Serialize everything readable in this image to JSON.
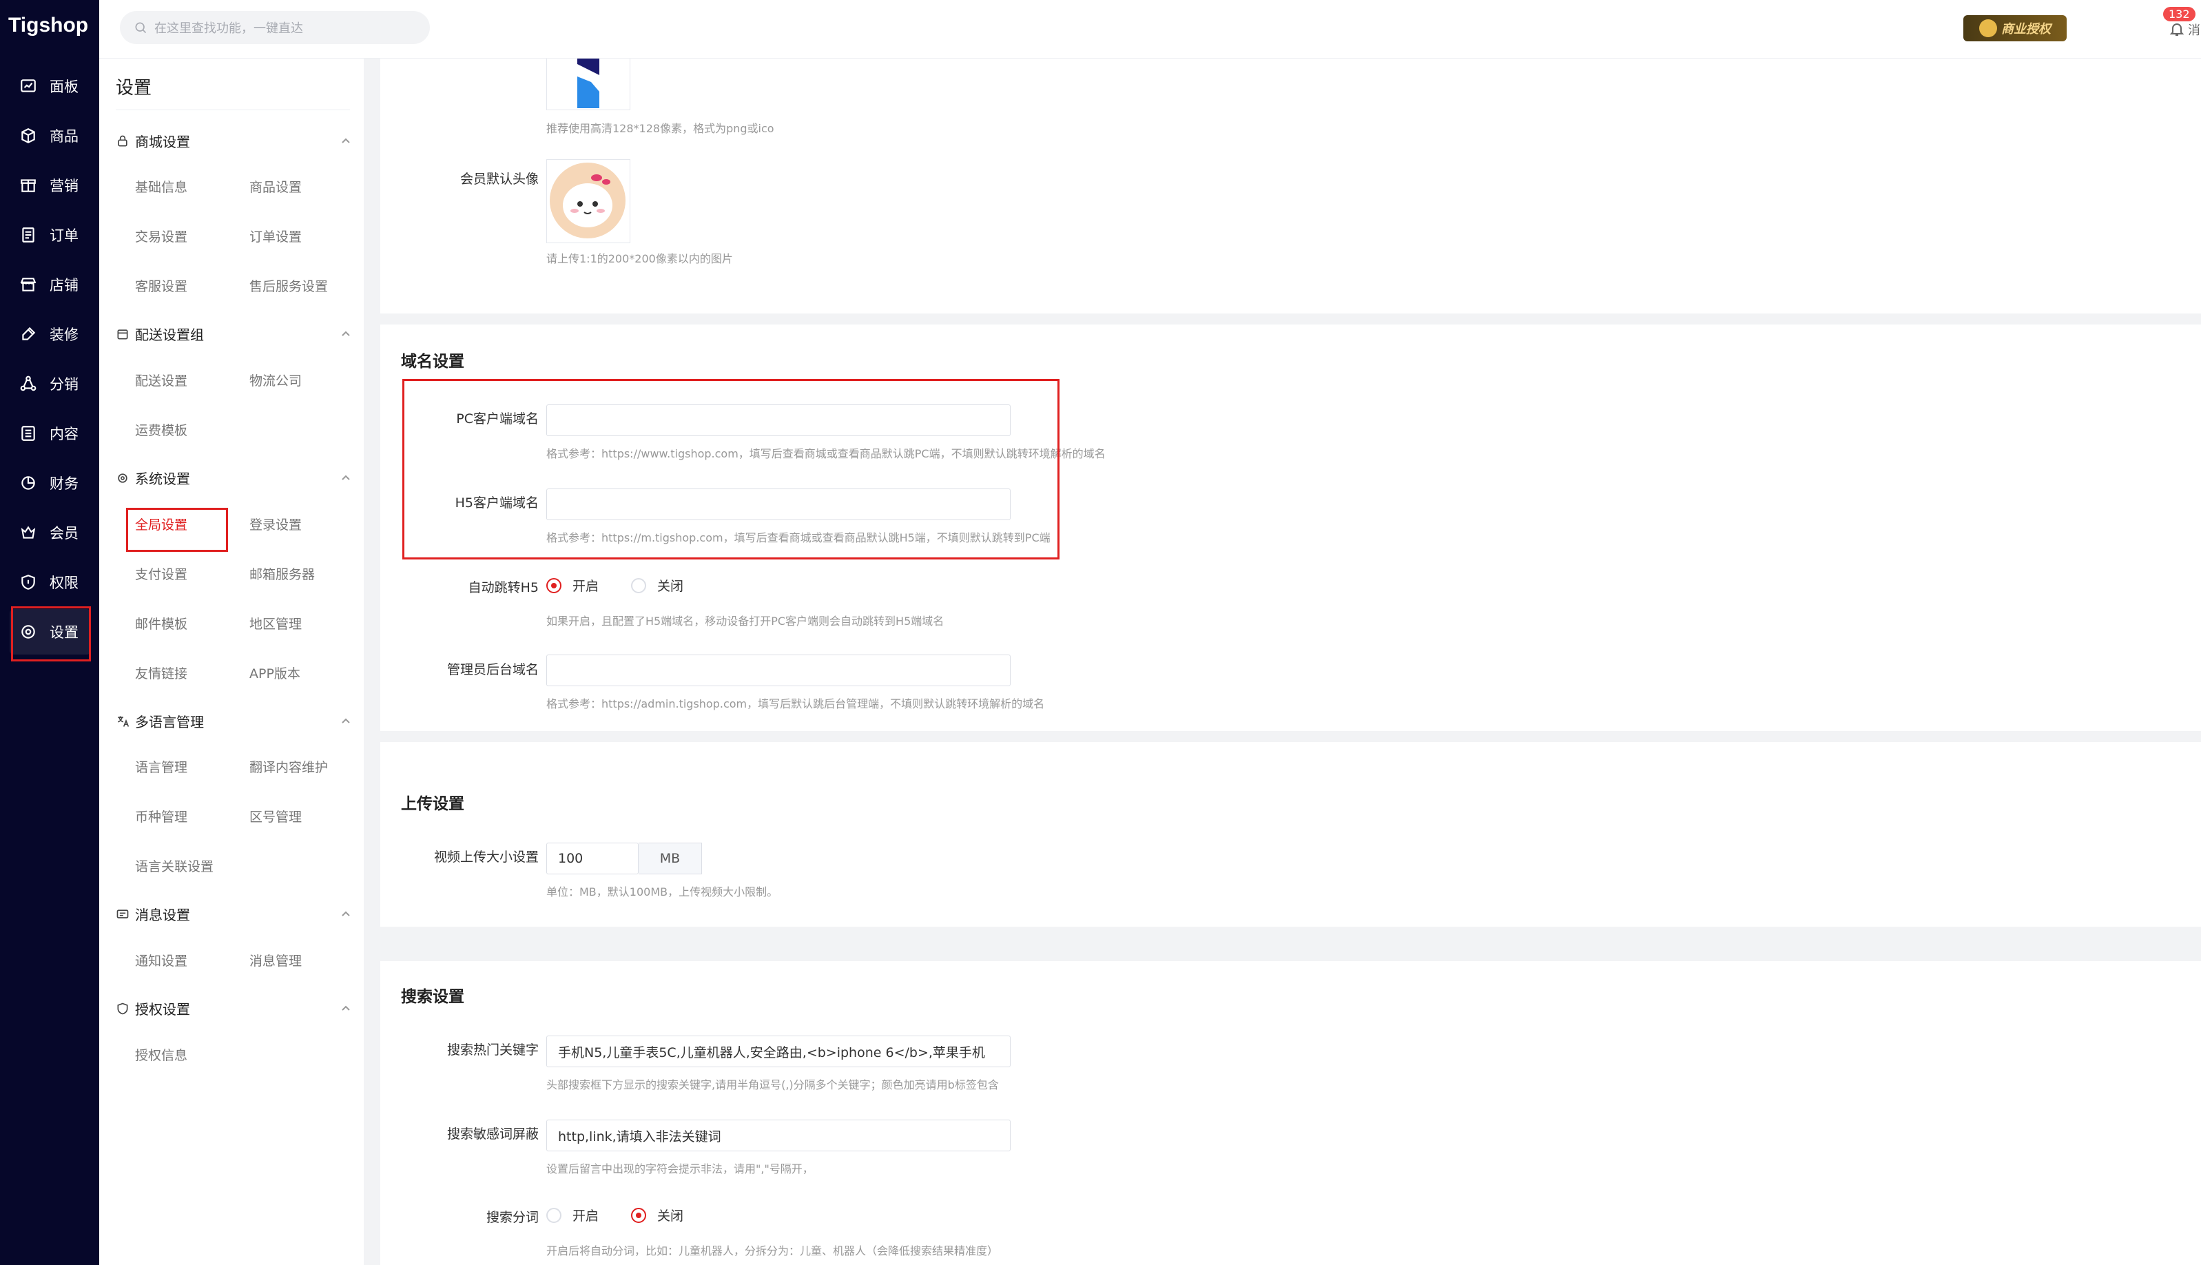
{
  "brand": {
    "logo_text": "Tigshop"
  },
  "topbar": {
    "search_placeholder": "在这里查找功能，一键直达",
    "license_label": "商业授权",
    "notification_count": "132",
    "notification_text": "消"
  },
  "sidebar": {
    "items": [
      {
        "label": "面板",
        "icon": "dashboard-icon"
      },
      {
        "label": "商品",
        "icon": "box-icon"
      },
      {
        "label": "营销",
        "icon": "marketing-icon"
      },
      {
        "label": "订单",
        "icon": "order-icon"
      },
      {
        "label": "店铺",
        "icon": "store-icon"
      },
      {
        "label": "装修",
        "icon": "brush-icon"
      },
      {
        "label": "分销",
        "icon": "share-icon"
      },
      {
        "label": "内容",
        "icon": "content-icon"
      },
      {
        "label": "财务",
        "icon": "finance-icon"
      },
      {
        "label": "会员",
        "icon": "member-icon"
      },
      {
        "label": "权限",
        "icon": "shield-icon"
      },
      {
        "label": "设置",
        "icon": "settings-icon",
        "active": true
      }
    ]
  },
  "submenu": {
    "title": "设置",
    "groups": [
      {
        "label": "商城设置",
        "items": [
          "基础信息",
          "商品设置",
          "交易设置",
          "订单设置",
          "客服设置",
          "售后服务设置"
        ]
      },
      {
        "label": "配送设置组",
        "items": [
          "配送设置",
          "物流公司",
          "运费模板"
        ]
      },
      {
        "label": "系统设置",
        "items": [
          "全局设置",
          "登录设置",
          "支付设置",
          "邮箱服务器",
          "邮件模板",
          "地区管理",
          "友情链接",
          "APP版本"
        ]
      },
      {
        "label": "多语言管理",
        "items": [
          "语言管理",
          "翻译内容维护",
          "币种管理",
          "区号管理",
          "语言关联设置"
        ]
      },
      {
        "label": "消息设置",
        "items": [
          "通知设置",
          "消息管理"
        ]
      },
      {
        "label": "授权设置",
        "items": [
          "授权信息"
        ]
      }
    ],
    "active_item": "全局设置"
  },
  "images_section": {
    "icon_hint": "推荐使用高清128*128像素，格式为png或ico",
    "avatar_label": "会员默认头像",
    "avatar_hint": "请上传1:1的200*200像素以内的图片"
  },
  "domain_section": {
    "title": "域名设置",
    "pc_label": "PC客户端域名",
    "pc_value": "",
    "pc_hint": "格式参考：https://www.tigshop.com，填写后查看商城或查看商品默认跳PC端，不填则默认跳转环境解析的域名",
    "h5_label": "H5客户端域名",
    "h5_value": "",
    "h5_hint": "格式参考：https://m.tigshop.com，填写后查看商城或查看商品默认跳H5端，不填则默认跳转到PC端",
    "auto_label": "自动跳转H5",
    "auto_on": "开启",
    "auto_off": "关闭",
    "auto_selected": "开启",
    "auto_hint": "如果开启，且配置了H5端域名，移动设备打开PC客户端则会自动跳转到H5端域名",
    "admin_label": "管理员后台域名",
    "admin_value": "",
    "admin_hint": "格式参考：https://admin.tigshop.com，填写后默认跳后台管理端，不填则默认跳转环境解析的域名"
  },
  "upload_section": {
    "title": "上传设置",
    "video_label": "视频上传大小设置",
    "video_value": "100",
    "video_unit": "MB",
    "video_hint": "单位：MB，默认100MB，上传视频大小限制。"
  },
  "search_section": {
    "title": "搜索设置",
    "hot_label": "搜索热门关键字",
    "hot_value": "手机N5,儿童手表5C,儿童机器人,安全路由,<b>iphone 6</b>,苹果手机",
    "hot_hint": "头部搜索框下方显示的搜索关键字,请用半角逗号(,)分隔多个关键字；颜色加亮请用b标签包含",
    "sensitive_label": "搜索敏感词屏蔽",
    "sensitive_value": "http,link,请填入非法关键词",
    "sensitive_hint": "设置后留言中出现的字符会提示非法，请用\",\"号隔开，",
    "segment_label": "搜索分词",
    "segment_on": "开启",
    "segment_off": "关闭",
    "segment_selected": "关闭",
    "segment_hint": "开启后将自动分词，比如：儿童机器人，分拆分为：儿童、机器人（会降低搜索结果精准度）"
  },
  "colors": {
    "accent": "#e02020",
    "sidebar_bg": "#06072a",
    "page_bg": "#f2f3f5"
  }
}
